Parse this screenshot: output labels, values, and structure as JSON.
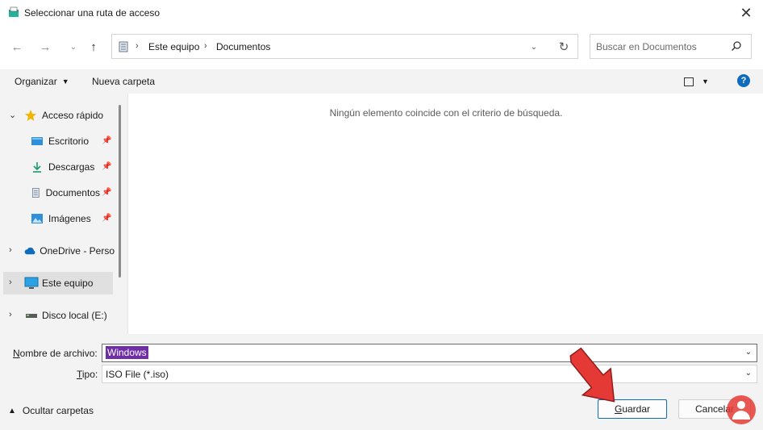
{
  "window": {
    "title": "Seleccionar una ruta de acceso",
    "title_icon": "folder-app-icon",
    "close_icon": "close-icon"
  },
  "navigation": {
    "back_icon": "arrow-left-icon",
    "forward_icon": "arrow-right-icon",
    "recent_icon": "chevron-down-icon",
    "up_icon": "arrow-up-icon"
  },
  "address_bar": {
    "icon": "documents-icon",
    "crumbs": [
      "Este equipo",
      "Documentos"
    ],
    "separator": "›",
    "dropdown_icon": "chevron-down-icon",
    "refresh_icon": "refresh-icon"
  },
  "search": {
    "placeholder": "Buscar en Documentos",
    "value": "",
    "icon": "search-icon"
  },
  "toolbar": {
    "organize_label": "Organizar",
    "new_folder_label": "Nueva carpeta",
    "view_icon": "view-square-icon",
    "help_icon": "help-icon",
    "help_glyph": "?"
  },
  "nav_pane": {
    "quick_access": {
      "label": "Acceso rápido",
      "expanded": true,
      "items": [
        {
          "label": "Escritorio",
          "icon": "desktop-icon",
          "pinned": true
        },
        {
          "label": "Descargas",
          "icon": "download-icon",
          "pinned": true
        },
        {
          "label": "Documentos",
          "icon": "documents-icon",
          "pinned": true
        },
        {
          "label": "Imágenes",
          "icon": "pictures-icon",
          "pinned": true
        }
      ]
    },
    "onedrive": {
      "label": "OneDrive - Perso",
      "icon": "cloud-icon"
    },
    "this_pc": {
      "label": "Este equipo",
      "icon": "computer-icon",
      "selected": true
    },
    "local_disk": {
      "label": "Disco local (E:)",
      "icon": "drive-icon"
    }
  },
  "content": {
    "empty_message": "Ningún elemento coincide con el criterio de búsqueda."
  },
  "form": {
    "filename_label_accesskey": "N",
    "filename_label_rest": "ombre de archivo:",
    "filename_value": "Windows",
    "type_label_accesskey": "T",
    "type_label_rest": "ipo:",
    "type_value": "ISO File (*.iso)"
  },
  "footer": {
    "hide_folders_label": "Ocultar carpetas",
    "save_accesskey": "G",
    "save_rest": "uardar",
    "cancel_label": "Cancelar"
  },
  "colors": {
    "selection": "#6f2da8",
    "accent": "#0f6cbd",
    "arrow": "#e53935"
  }
}
